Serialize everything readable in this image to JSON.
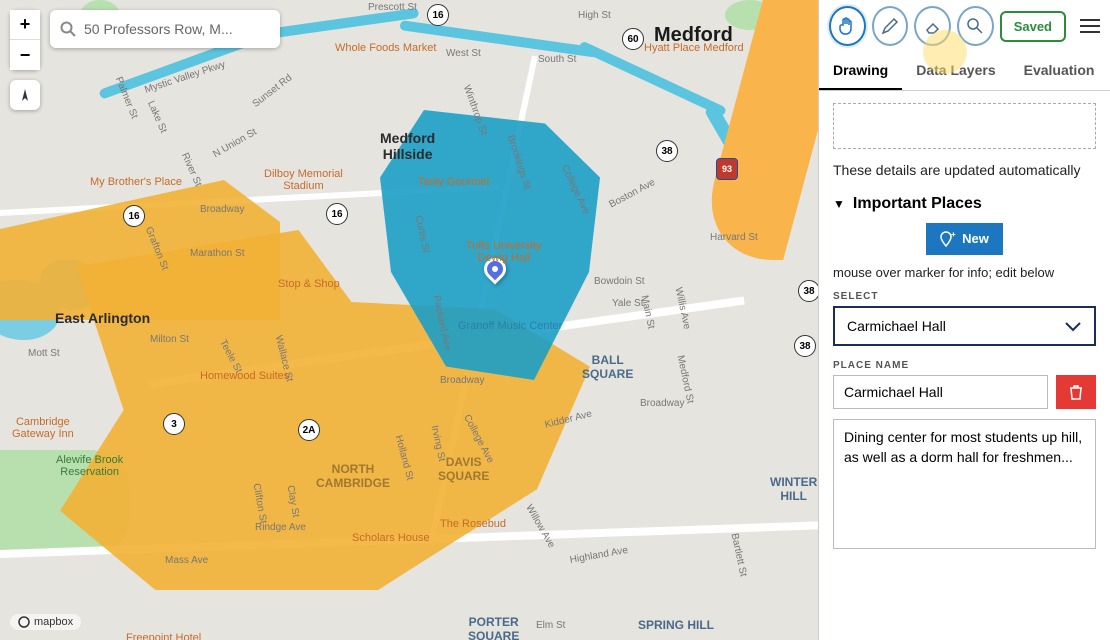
{
  "search": {
    "value": "50 Professors Row, M..."
  },
  "map": {
    "city": "Medford",
    "neighborhoods": {
      "hillside": "Medford\nHillside",
      "east_arlington": "East Arlington",
      "davis": "DAVIS\nSQUARE",
      "north_cambridge": "NORTH\nCAMBRIDGE",
      "ball": "BALL\nSQUARE",
      "porter": "PORTER\nSQUARE",
      "winter_hill": "WINTER\nHILL",
      "spring_hill": "SPRING HILL"
    },
    "poi": {
      "whole_foods": "Whole Foods Market",
      "my_brothers": "My Brother's Place",
      "dilboy": "Dilboy Memorial\nStadium",
      "tasty": "Tasty Gourmet",
      "tufts_dining": "Tufts University\nDewig Hall",
      "granoff": "Granoff Music Center",
      "stop_shop": "Stop & Shop",
      "homewood": "Homewood Suites",
      "gateway": "Cambridge\nGateway Inn",
      "alewife": "Alewife Brook\nReservation",
      "rosebud": "The Rosebud",
      "scholars": "Scholars House",
      "hyatt": "Hyatt Place Medford",
      "freepoint": "Freepoint Hotel"
    },
    "streets": {
      "mystic_valley": "Mystic Valley Pkwy",
      "broadway": "Broadway",
      "boston_ave": "Boston Ave",
      "college_ave": "College Ave",
      "high_st": "High St",
      "winthrop": "Winthrop St",
      "south_st": "South St",
      "west_st": "West St",
      "highland": "Highland Ave",
      "mass_ave": "Mass Ave",
      "rindge": "Rindge Ave",
      "willow": "Willow Ave",
      "holland": "Holland St",
      "elm": "Elm St",
      "packard": "Packard Ave",
      "curtis": "Curtis St",
      "main_st": "Main St",
      "yale": "Yale St",
      "bowdoin": "Bowdoin St",
      "brookings": "Brookings St",
      "medford_st": "Medford St",
      "harvard_st": "Harvard St",
      "kidder": "Kidder Ave",
      "irving": "Irving St",
      "clifton": "Clifton St",
      "clay": "Clay St",
      "teele": "Teele St",
      "wallace": "Wallace St",
      "grafton": "Grafton St",
      "river_st": "River St",
      "palmer": "Palmer St",
      "lake_st": "Lake St",
      "milton": "Milton St",
      "mott": "Mott St",
      "marathon": "Marathon St",
      "sunset": "Sunset Rd",
      "n_union": "N Union St",
      "prescott": "Prescott St",
      "bartlett": "Bartlett St",
      "willis": "Willis Ave"
    },
    "shields": {
      "r16": "16",
      "r60": "60",
      "r38": "38",
      "i93": "93",
      "r3": "3",
      "r2a": "2A"
    },
    "logo": "mapbox"
  },
  "toolbar": {
    "saved_label": "Saved",
    "tabs": {
      "drawing": "Drawing",
      "layers": "Data Layers",
      "eval": "Evaluation"
    }
  },
  "panel": {
    "update_hint": "These details are updated automatically",
    "section_title": "Important Places",
    "new_label": "New",
    "mouse_hint": "mouse over marker for info; edit below",
    "select_label": "SELECT",
    "select_value": "Carmichael Hall",
    "name_label": "PLACE NAME",
    "name_value": "Carmichael Hall",
    "desc_value": "Dining center for most students up hill, as well as a dorm hall for freshmen..."
  }
}
